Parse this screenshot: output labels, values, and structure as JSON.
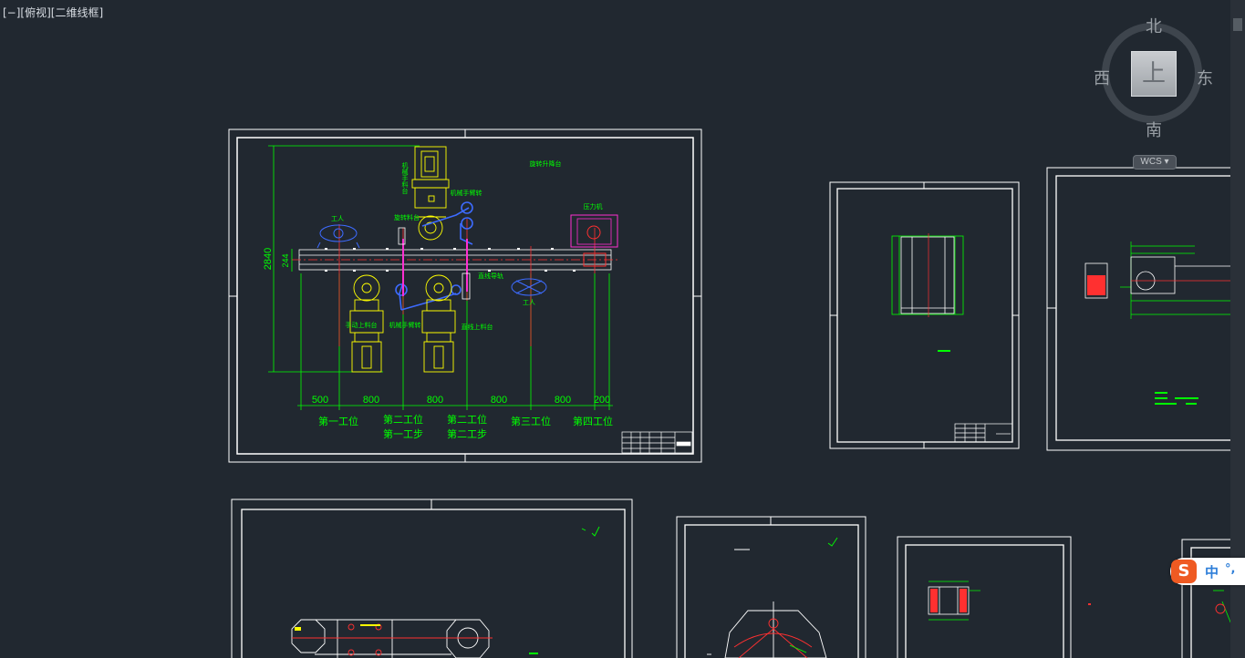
{
  "viewport_controls": {
    "menu": "[−]",
    "view": "[俯视]",
    "visual_style": "[二维线框]"
  },
  "viewcube": {
    "face": "上",
    "north": "北",
    "south": "南",
    "east": "东",
    "west": "西",
    "ucs": "WCS"
  },
  "drawing_main": {
    "dim_height": "2840",
    "dim_small": "244",
    "dims_bottom": [
      "500",
      "800",
      "800",
      "800",
      "800",
      "200"
    ],
    "stations": [
      "第一工位",
      "第二工位",
      "第二工位",
      "第三工位",
      "第四工位"
    ],
    "steps": [
      "第一工步",
      "第二工步"
    ],
    "labels": {
      "worker_left": "工人",
      "worker_right": "工人",
      "machine_right": "压力机",
      "top_note": "旋转升降台",
      "vertical_text": "机械手料台",
      "robot_top": "机械手臂转",
      "robot_bottom": "机械手臂转",
      "rail_note": "直线导轨",
      "material_left": "手动上料台",
      "material_right": "直线上料台",
      "feeder": "旋转料台"
    }
  },
  "ime": {
    "logo": "S",
    "mode": "中",
    "punct": "°,"
  },
  "colors": {
    "background": "#212830",
    "frame": "#ffffff",
    "dimension": "#00ff00",
    "part": "#ffff00",
    "robot": "#3d6bff",
    "press": "#ff2fd0",
    "center_line": "#ff3030",
    "viewcube_ring": "#3e454d"
  },
  "icons": [
    "sogou-ime-logo",
    "viewcube",
    "wcs-menu"
  ]
}
